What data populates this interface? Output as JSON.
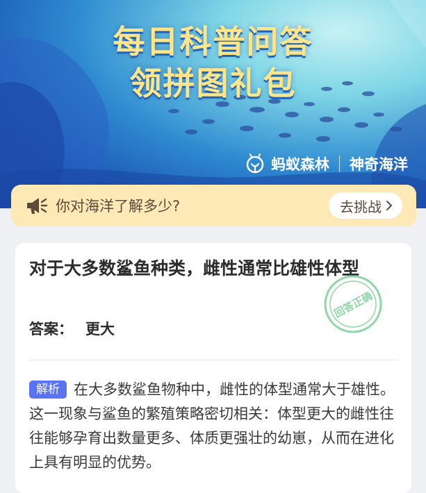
{
  "banner": {
    "title_line1": "每日科普问答",
    "title_line2": "领拼图礼包",
    "brand_name": "蚂蚁森林",
    "brand_sub": "神奇海洋"
  },
  "prompt": {
    "icon": "megaphone-icon",
    "text": "你对海洋了解多少?",
    "button_label": "去挑战"
  },
  "card": {
    "question": "对于大多数鲨鱼种类，雌性通常比雄性体型",
    "answer_label": "答案：",
    "answer_value": "更大",
    "stamp_text": "回答正确",
    "explain_tag": "解析",
    "explanation": "在大多数鲨鱼物种中，雌性的体型通常大于雄性。这一现象与鲨鱼的繁殖策略密切相关：体型更大的雌性往往能够孕育出数量更多、体质更强壮的幼崽，从而在进化上具有明显的优势。"
  },
  "colors": {
    "title": "#ffe58a",
    "prompt_bg": "#fde9b5",
    "tag": "#5a73f0",
    "stamp": "#8fd6a8"
  }
}
